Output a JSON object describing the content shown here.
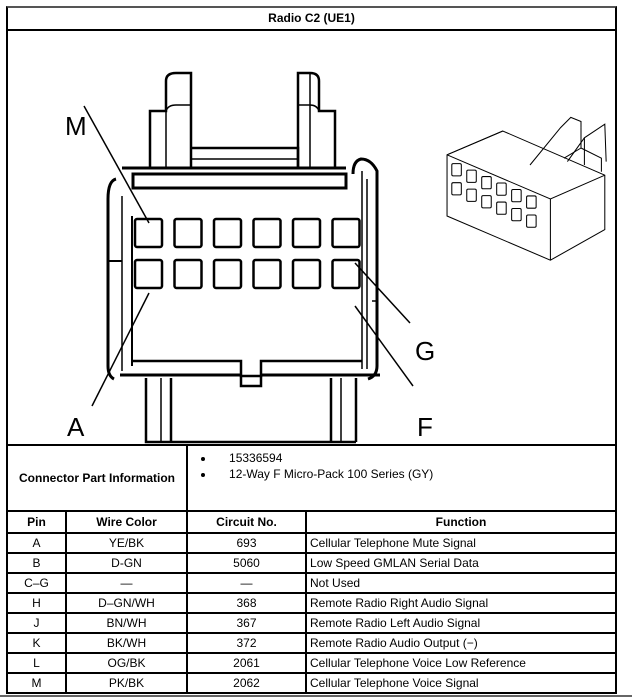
{
  "title": "Radio C2 (UE1)",
  "diagram": {
    "labels": {
      "M": "M",
      "A": "A",
      "G": "G",
      "F": "F"
    },
    "cavity_rows": 2,
    "cavity_cols": 6
  },
  "connector_part_info": {
    "label": "Connector Part Information",
    "items": [
      "15336594",
      "12-Way F Micro-Pack 100 Series (GY)"
    ]
  },
  "table": {
    "headers": [
      "Pin",
      "Wire Color",
      "Circuit No.",
      "Function"
    ],
    "rows": [
      {
        "pin": "A",
        "wire_color": "YE/BK",
        "circuit": "693",
        "function": "Cellular Telephone Mute Signal"
      },
      {
        "pin": "B",
        "wire_color": "D-GN",
        "circuit": "5060",
        "function": "Low Speed GMLAN Serial Data"
      },
      {
        "pin": "C–G",
        "wire_color": "—",
        "circuit": "—",
        "function": "Not Used"
      },
      {
        "pin": "H",
        "wire_color": "D–GN/WH",
        "circuit": "368",
        "function": "Remote Radio Right Audio Signal"
      },
      {
        "pin": "J",
        "wire_color": "BN/WH",
        "circuit": "367",
        "function": "Remote Radio Left Audio Signal"
      },
      {
        "pin": "K",
        "wire_color": "BK/WH",
        "circuit": "372",
        "function": "Remote Radio Audio Output (−)"
      },
      {
        "pin": "L",
        "wire_color": "OG/BK",
        "circuit": "2061",
        "function": "Cellular Telephone Voice Low Reference"
      },
      {
        "pin": "M",
        "wire_color": "PK/BK",
        "circuit": "2062",
        "function": "Cellular Telephone Voice Signal"
      }
    ]
  }
}
